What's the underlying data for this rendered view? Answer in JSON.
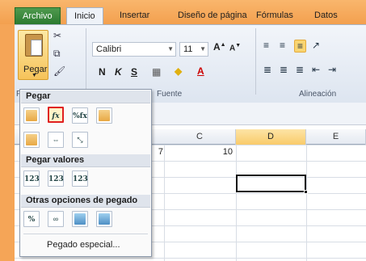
{
  "tabs": [
    {
      "label": "Archivo"
    },
    {
      "label": "Inicio"
    },
    {
      "label": "Insertar"
    },
    {
      "label": "Diseño de página"
    },
    {
      "label": "Fórmulas"
    },
    {
      "label": "Datos"
    }
  ],
  "ribbon": {
    "paste_label": "Pegar",
    "font_name": "Calibri",
    "font_size": "11",
    "bold": "N",
    "italic": "K",
    "underline": "S",
    "font_group_label": "Fuente",
    "align_group_label": "Alineación",
    "clipboard_group_short": "P"
  },
  "grid": {
    "columns": [
      "C",
      "D",
      "E"
    ],
    "selected_column": "D",
    "values": {
      "b2": "7",
      "c2": "10"
    }
  },
  "paste_menu": {
    "sections": {
      "pegar": "Pegar",
      "pegar_valores": "Pegar valores",
      "otras": "Otras opciones de pegado"
    },
    "icons": {
      "pegar": [
        "paste-icon",
        "formulas-icon",
        "formulas-number-format-icon",
        "keep-source-format-icon",
        "no-borders-icon",
        "keep-column-width-icon",
        "transpose-icon"
      ],
      "valores": [
        "values-icon",
        "values-number-format-icon",
        "values-source-format-icon"
      ],
      "otras": [
        "formatting-icon",
        "paste-link-icon",
        "picture-icon",
        "linked-picture-icon"
      ]
    },
    "icon_labels": {
      "fx": "fx",
      "pct_fx": "%fx",
      "v123": "123",
      "pct": "%"
    },
    "special": "Pegado especial..."
  },
  "colors": {
    "background": "#f5a557",
    "highlight_border": "#e02020",
    "archivo_tab": "#2c7a30"
  }
}
